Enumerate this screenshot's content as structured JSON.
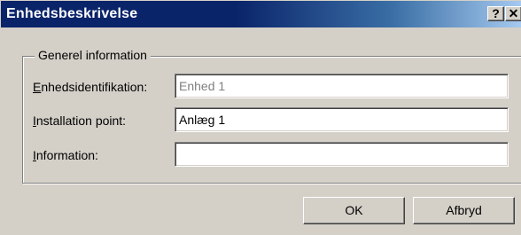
{
  "window": {
    "title": "Enhedsbeskrivelse",
    "help_label": "?",
    "close_label": "✕"
  },
  "group": {
    "title": "Generel information"
  },
  "fields": [
    {
      "label_first": "E",
      "label_rest": "nhedsidentifikation:",
      "value": "Enhed 1",
      "enabled": false
    },
    {
      "label_first": "I",
      "label_rest": "nstallation point:",
      "value": "Anlæg 1",
      "enabled": true
    },
    {
      "label_first": "I",
      "label_rest": "nformation:",
      "value": "",
      "enabled": true
    }
  ],
  "buttons": {
    "ok": "OK",
    "cancel": "Afbryd"
  },
  "colors": {
    "title_bar_start": "#0a246a",
    "title_bar_end": "#a6caf0",
    "dialog_face": "#d4d0c8"
  }
}
